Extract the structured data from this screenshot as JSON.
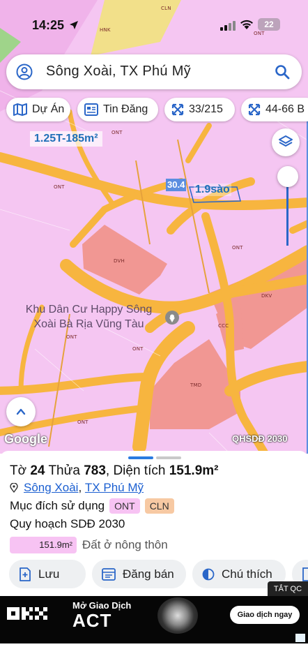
{
  "status_bar": {
    "time": "14:25",
    "battery": "22"
  },
  "search": {
    "value": "Sông Xoài, TX Phú Mỹ"
  },
  "filters": [
    {
      "label": "Dự Án",
      "icon": "map-icon"
    },
    {
      "label": "Tin Đăng",
      "icon": "news-icon"
    },
    {
      "label": "33/215",
      "icon": "arrows-icon"
    },
    {
      "label": "44-66 B",
      "icon": "arrows-icon"
    }
  ],
  "map": {
    "price_label": "1.25T-185m²",
    "parcel_number": "30.4",
    "area_label": "1.9sào",
    "place_name": "Khu Dân Cư Happy Sông Xoài Bà Rịa Vũng Tàu",
    "zones": [
      "CLN",
      "HNK",
      "ONT",
      "ONT",
      "ONT",
      "ONT",
      "DVH",
      "ONT",
      "ONT",
      "DKV",
      "CCC",
      "TMD",
      "ONT"
    ],
    "google_logo": "Google",
    "layer_name": "QHSDĐ 2030",
    "colors": {
      "residential": "#f5c6f2",
      "road": "#f7b53f",
      "service": "#f19793",
      "route": "#e6a23c"
    }
  },
  "parcel": {
    "to_label": "Tờ",
    "to_value": "24",
    "thua_label": "Thửa",
    "thua_value": "783",
    "dientich_label": "Diện tích",
    "dientich_value": "151.9m²",
    "ward": "Sông Xoài",
    "separator": ",",
    "district": "TX Phú Mỹ",
    "purpose_label": "Mục đích sử dụng",
    "purpose_tags": [
      "ONT",
      "CLN"
    ],
    "plan_label": "Quy hoạch SDĐ 2030",
    "plan_area": "151.9m²",
    "plan_desc": "Đất ở nông thôn"
  },
  "actions": [
    {
      "label": "Lưu",
      "icon": "save-icon"
    },
    {
      "label": "Đăng bán",
      "icon": "post-icon"
    },
    {
      "label": "Chú thích",
      "icon": "legend-icon"
    }
  ],
  "ad": {
    "hide_label": "TẮT QC",
    "brand": "OKX",
    "headline_small": "Mở Giao Dịch",
    "headline_big": "ACT",
    "cta": "Giao dịch ngay"
  }
}
